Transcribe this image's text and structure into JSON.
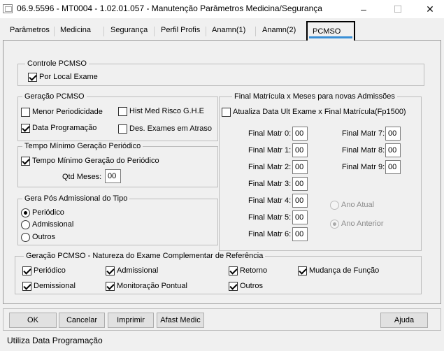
{
  "window": {
    "title": "06.9.5596 - MT0004 - 1.02.01.057 - Manutenção Parâmetros Medicina/Segurança",
    "minimize": "–",
    "maximize": "☐",
    "close": "✕"
  },
  "tabs": [
    {
      "label": "Parâmetros"
    },
    {
      "label": "Medicina"
    },
    {
      "label": "Segurança"
    },
    {
      "label": "Perfil Profis"
    },
    {
      "label": "Anamn(1)"
    },
    {
      "label": "Anamn(2)"
    },
    {
      "label": "PCMSO",
      "active": true
    }
  ],
  "controle": {
    "legend": "Controle PCMSO",
    "por_local_exame": {
      "label": "Por Local Exame",
      "checked": true
    }
  },
  "geracao": {
    "legend": "Geração PCMSO",
    "menor_periodicidade": {
      "label": "Menor Periodicidade",
      "checked": false
    },
    "hist_med_risco": {
      "label": "Hist Med Risco G.H.E",
      "checked": false
    },
    "data_programacao": {
      "label": "Data Programação",
      "checked": true
    },
    "des_exames_atraso": {
      "label": "Des. Exames em Atraso",
      "checked": false
    }
  },
  "tempo_minimo": {
    "legend": "Tempo Mínimo Geração Periódico",
    "checkbox": {
      "label": "Tempo Mínimo Geração do Periódico",
      "checked": true
    },
    "qtd_meses_label": "Qtd Meses:",
    "qtd_meses_value": "00"
  },
  "gera_pos": {
    "legend": "Gera Pós Admissional do Tipo",
    "options": [
      {
        "label": "Periódico",
        "selected": true
      },
      {
        "label": "Admissional",
        "selected": false
      },
      {
        "label": "Outros",
        "selected": false
      }
    ]
  },
  "final_matricula": {
    "legend": "Final Matrícula x Meses para novas Admissões",
    "atualiza": {
      "label": "Atualiza Data Ult Exame x Final Matrícula(Fp1500)",
      "checked": false
    },
    "fields": [
      {
        "label": "Final Matr 0:",
        "value": "00"
      },
      {
        "label": "Final Matr 1:",
        "value": "00"
      },
      {
        "label": "Final Matr 2:",
        "value": "00"
      },
      {
        "label": "Final Matr 3:",
        "value": "00"
      },
      {
        "label": "Final Matr 4:",
        "value": "00"
      },
      {
        "label": "Final Matr 5:",
        "value": "00"
      },
      {
        "label": "Final Matr 6:",
        "value": "00"
      },
      {
        "label": "Final Matr 7:",
        "value": "00"
      },
      {
        "label": "Final Matr 8:",
        "value": "00"
      },
      {
        "label": "Final Matr 9:",
        "value": "00"
      }
    ],
    "ano_atual": {
      "label": "Ano Atual",
      "selected": false,
      "disabled": true
    },
    "ano_anterior": {
      "label": "Ano Anterior",
      "selected": true,
      "disabled": true
    }
  },
  "natureza": {
    "legend": "Geração PCMSO - Natureza do Exame Complementar de Referência",
    "items": [
      {
        "label": "Periódico",
        "checked": true
      },
      {
        "label": "Admissional",
        "checked": true
      },
      {
        "label": "Retorno",
        "checked": true
      },
      {
        "label": "Mudança de Função",
        "checked": true
      },
      {
        "label": "Demissional",
        "checked": true
      },
      {
        "label": "Monitoração Pontual",
        "checked": true
      },
      {
        "label": "Outros",
        "checked": true
      }
    ]
  },
  "buttons": {
    "ok": "OK",
    "cancelar": "Cancelar",
    "imprimir": "Imprimir",
    "afast_medic": "Afast Medic",
    "ajuda": "Ajuda"
  },
  "status_text": "Utiliza Data Programação"
}
